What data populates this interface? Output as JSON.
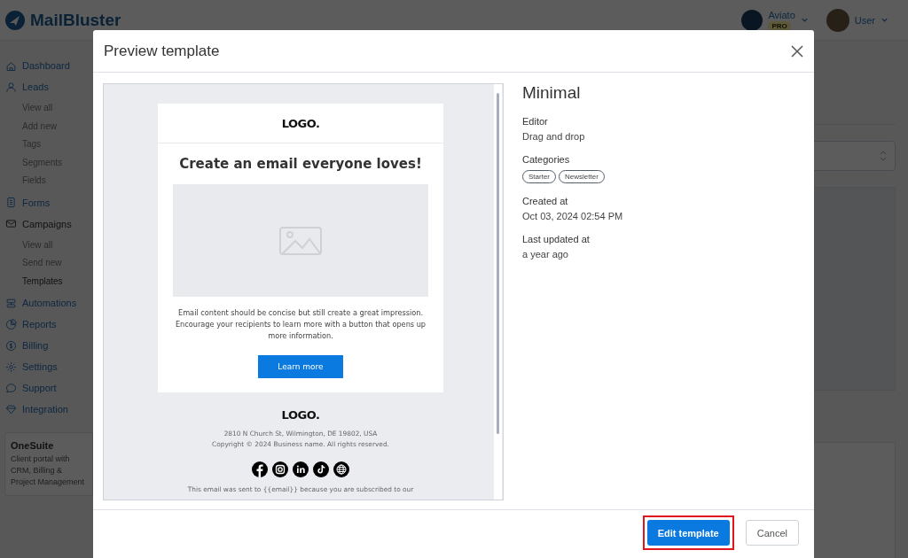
{
  "app": {
    "logo": "MailBluster",
    "account": {
      "name": "Aviato",
      "badge": "PRO"
    },
    "user": {
      "name": "User"
    }
  },
  "sidebar": {
    "items": [
      {
        "label": "Dashboard",
        "selected": false
      },
      {
        "label": "Leads",
        "selected": false,
        "children": [
          {
            "label": "View all",
            "selected": false
          },
          {
            "label": "Add new",
            "selected": false
          },
          {
            "label": "Tags",
            "selected": false
          },
          {
            "label": "Segments",
            "selected": false
          },
          {
            "label": "Fields",
            "selected": false
          }
        ]
      },
      {
        "label": "Forms",
        "selected": false
      },
      {
        "label": "Campaigns",
        "selected": true,
        "children": [
          {
            "label": "View all",
            "selected": false
          },
          {
            "label": "Send new",
            "selected": false
          },
          {
            "label": "Templates",
            "selected": true
          }
        ]
      },
      {
        "label": "Automations",
        "selected": false
      },
      {
        "label": "Reports",
        "selected": false
      },
      {
        "label": "Billing",
        "selected": false
      },
      {
        "label": "Settings",
        "selected": false
      },
      {
        "label": "Support",
        "selected": false
      },
      {
        "label": "Integration",
        "selected": false
      }
    ]
  },
  "promo": {
    "title": "OneSuite",
    "text": "Client portal with CRM, Billing & Project Management"
  },
  "modal": {
    "title": "Preview template",
    "preview": {
      "logo": "LOGO.",
      "heading": "Create an email everyone loves!",
      "body": "Email content should be concise but still create a great impression. Encourage your recipients to learn more with a button that opens up more information.",
      "button": "Learn more",
      "footer_logo": "LOGO.",
      "address": "2810 N Church St, Wilmington, DE 19802, USA",
      "copyright": "Copyright © 2024 Business name. All rights reserved.",
      "notice": "This email was sent to {{email}} because you are subscribed to our"
    },
    "details": {
      "name": "Minimal",
      "fields": [
        {
          "label": "Editor",
          "value": "Drag and drop"
        },
        {
          "label": "Categories",
          "tags": [
            "Starter",
            "Newsletter"
          ]
        },
        {
          "label": "Created at",
          "value": "Oct 03, 2024 02:54 PM"
        },
        {
          "label": "Last updated at",
          "value": "a year ago"
        }
      ]
    },
    "buttons": [
      {
        "label": "Edit template",
        "kind": "primary",
        "highlighted": true
      },
      {
        "label": "Cancel",
        "kind": "secondary",
        "highlighted": false
      }
    ]
  }
}
